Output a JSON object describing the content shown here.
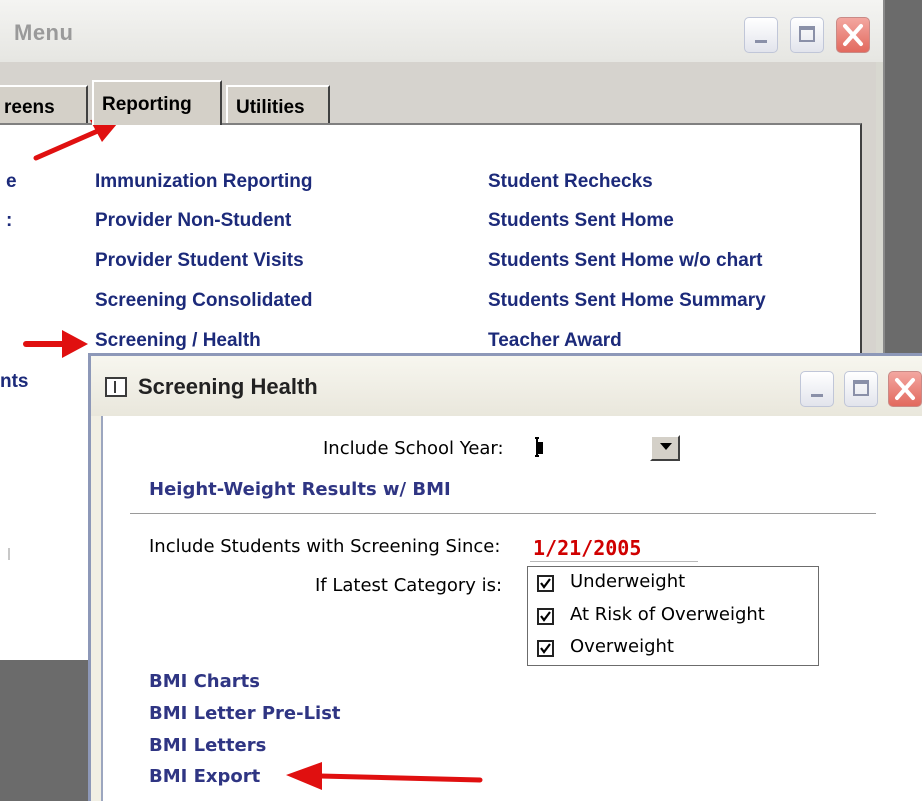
{
  "menu_window": {
    "title": "Menu",
    "tabs": [
      {
        "label": "reens"
      },
      {
        "label": "Reporting"
      },
      {
        "label": "Utilities"
      }
    ],
    "left_fragments": [
      "e",
      ":",
      "nts"
    ],
    "links_col1": [
      "Immunization Reporting",
      "Provider Non-Student",
      "Provider Student Visits",
      "Screening Consolidated",
      "Screening / Health"
    ],
    "links_col2": [
      "Student Rechecks",
      "Students Sent Home",
      "Students Sent Home w/o chart",
      "Students Sent Home Summary",
      "Teacher Award"
    ]
  },
  "dialog": {
    "title": "Screening Health",
    "school_year_label": "Include School Year:",
    "school_year_value": "",
    "height_weight_link": "Height-Weight Results w/ BMI",
    "screening_since_label": "Include Students with Screening Since:",
    "screening_since_value": "1/21/2005",
    "latest_category_label": "If Latest Category is:",
    "categories": [
      {
        "label": "Underweight",
        "checked": true
      },
      {
        "label": "At Risk of Overweight",
        "checked": true
      },
      {
        "label": "Overweight",
        "checked": true
      }
    ],
    "bmi_links": [
      "BMI Charts",
      "BMI Letter Pre-List",
      "BMI Letters",
      "BMI Export"
    ]
  },
  "colors": {
    "link": "#1c2a7a",
    "dialog_link": "#2f3583",
    "date_value": "#d00000",
    "arrow": "#e01010",
    "close_button": "#e2695e"
  },
  "icons": [
    "minimize-icon",
    "maximize-icon",
    "close-icon",
    "form-icon",
    "dropdown-arrow-icon",
    "checkmark-icon",
    "red-arrow-annotation"
  ]
}
